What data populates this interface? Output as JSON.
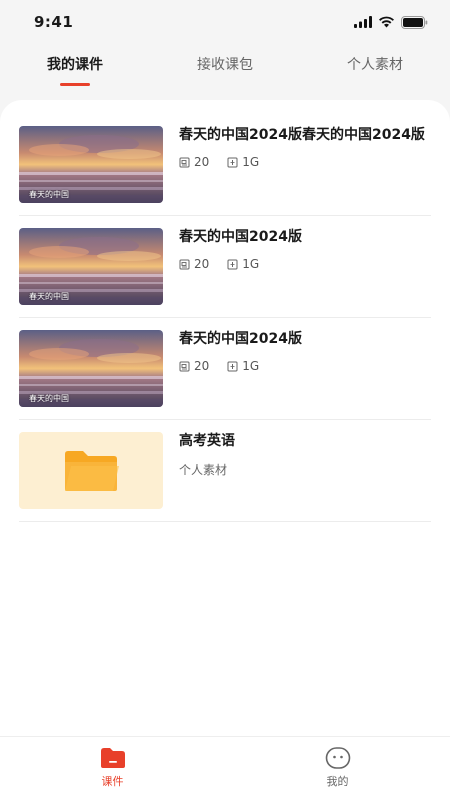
{
  "status": {
    "time": "9:41"
  },
  "tabs": [
    {
      "label": "我的课件",
      "active": true
    },
    {
      "label": "接收课包",
      "active": false
    },
    {
      "label": "个人素材",
      "active": false
    }
  ],
  "items": [
    {
      "title": "春天的中国2024版春天的中国2024版",
      "caption": "春天的中国",
      "pages": "20",
      "size": "1G"
    },
    {
      "title": "春天的中国2024版",
      "caption": "春天的中国",
      "pages": "20",
      "size": "1G"
    },
    {
      "title": "春天的中国2024版",
      "caption": "春天的中国",
      "pages": "20",
      "size": "1G"
    },
    {
      "title": "高考英语",
      "subtitle": "个人素材",
      "type": "folder"
    }
  ],
  "nav": [
    {
      "label": "课件",
      "icon": "courseware-icon",
      "active": true
    },
    {
      "label": "我的",
      "icon": "profile-icon",
      "active": false
    }
  ],
  "colors": {
    "accent": "#e8402a",
    "folder": "#f7a823",
    "folder_bg": "#fdefd2"
  }
}
